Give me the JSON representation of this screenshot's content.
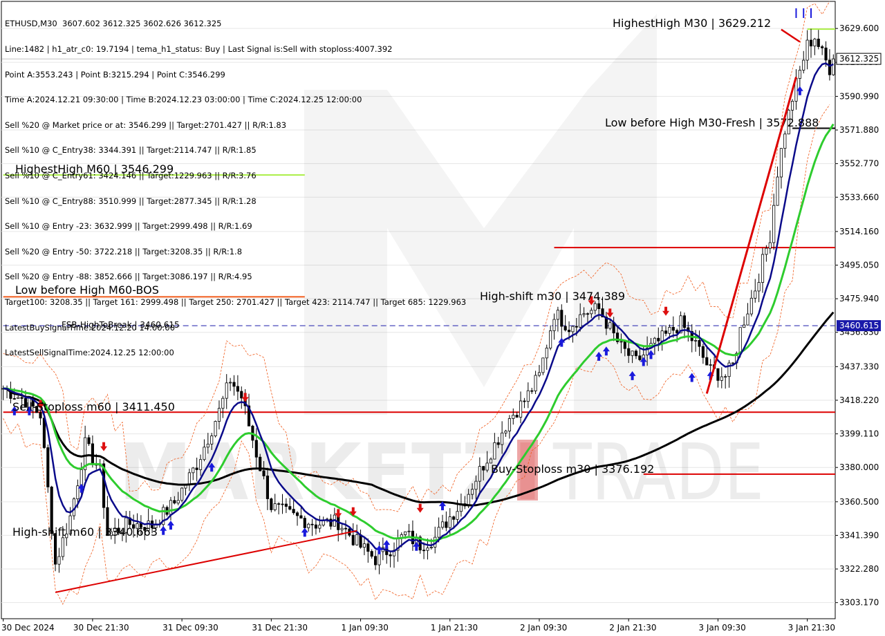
{
  "header": {
    "lines": [
      "ETHUSD,M30  3607.602 3612.325 3602.626 3612.325",
      "Line:1482 | h1_atr_c0: 19.7194 | tema_h1_status: Buy | Last Signal is:Sell with stoploss:4007.392",
      "Point A:3553.243 | Point B:3215.294 | Point C:3546.299",
      "Time A:2024.12.21 09:30:00 | Time B:2024.12.23 03:00:00 | Time C:2024.12.25 12:00:00",
      "Sell %20 @ Market price or at: 3546.299 || Target:2701.427 || R/R:1.83",
      "Sell %10 @ C_Entry38: 3344.391 || Target:2114.747 || R/R:1.85",
      "Sell %10 @ C_Entry61: 3424.146 || Target:1229.963 || R/R:3.76",
      "Sell %10 @ C_Entry88: 3510.999 || Target:2877.345 || R/R:1.28",
      "Sell %10 @ Entry -23: 3632.999 || Target:2999.498 || R/R:1.69",
      "Sell %20 @ Entry -50: 3722.218 || Target:3208.35 || R/R:1.8",
      "Sell %20 @ Entry -88: 3852.666 || Target:3086.197 || R/R:4.95",
      "Target100: 3208.35 || Target 161: 2999.498 || Target 250: 2701.427 || Target 423: 2114.747 || Target 685: 1229.963",
      "LatestBuySignalTime:2024.12.20 14:00:00",
      "LatestSellSignalTime:2024.12.25 12:00:00"
    ]
  },
  "watermark": {
    "brand_left": "MARKETZ",
    "brand_i": "I",
    "brand_right": "TRADE"
  },
  "colors": {
    "bg": "#ffffff",
    "grid": "#e6e6e6",
    "candle": "#000000",
    "fast_ma": "#0a0a8a",
    "mid_ma": "#2ecc2e",
    "slow_ma": "#000000",
    "channel": "#f05a1a",
    "level_red": "#dd0000",
    "level_green": "#aaee44",
    "current_price_bg": "#ffffff",
    "fsb_blue": "#1a1aaa"
  },
  "chart_data": {
    "type": "candlestick",
    "symbol": "ETHUSD",
    "timeframe": "M30",
    "ylim": [
      3294,
      3645
    ],
    "y_ticks": [
      3629.6,
      3610.35,
      3590.99,
      3571.88,
      3552.77,
      3533.66,
      3514.16,
      3495.05,
      3475.94,
      3456.83,
      3437.33,
      3418.22,
      3399.11,
      3380.0,
      3360.5,
      3341.39,
      3322.28,
      3303.17
    ],
    "y_tick_labels": [
      "3629.600",
      "3610.350",
      "3590.990",
      "3571.880",
      "3552.770",
      "3533.660",
      "3514.160",
      "3495.050",
      "3475.940",
      "3456.830",
      "3437.330",
      "3418.220",
      "3399.110",
      "3380.000",
      "3360.500",
      "3341.390",
      "3322.280",
      "3303.170"
    ],
    "x_tick_labels": [
      "30 Dec 2024",
      "30 Dec 21:30",
      "31 Dec 09:30",
      "31 Dec 21:30",
      "1 Jan 09:30",
      "1 Jan 21:30",
      "2 Jan 09:30",
      "2 Jan 21:30",
      "3 Jan 09:30",
      "3 Jan 21:30"
    ],
    "x_tick_index": [
      0,
      24,
      48,
      72,
      96,
      120,
      144,
      168,
      192,
      216
    ],
    "current_price": 3612.325,
    "current_price_label": "3612.325",
    "fsb_level": 3460.615,
    "fsb_label_right": "3460.615",
    "levels": [
      {
        "label": "HighestHigh   M30 | 3629.212",
        "value": 3629.212,
        "color": "#aaee44",
        "x0": 216,
        "x1": 224
      },
      {
        "label": "Low before High   M30-Fresh | 3572.888",
        "value": 3572.888,
        "color": "#000000",
        "x0": 212,
        "x1": 224
      },
      {
        "label": "HighestHigh   M60 | 3546.299",
        "value": 3546.299,
        "color": "#aaee44",
        "x0": 0,
        "x1": 81
      },
      {
        "label": "",
        "value": 3505.0,
        "color": "#dd0000",
        "x0": 148,
        "x1": 300
      },
      {
        "label": "High-shift m30 | 3474.389",
        "value": 3474.389,
        "color": "",
        "x0": 172,
        "x1": 172
      },
      {
        "label": "Low before High   M60-BOS",
        "value": 3477.0,
        "color": "#f05a1a",
        "x0": 0,
        "x1": 81
      },
      {
        "label": "FSB-HighToBreak | 3460.615",
        "value": 3460.615,
        "color": "#1a1aaa",
        "x0": 0,
        "x1": 300
      },
      {
        "label": "Sell-Stoploss m60 | 3411.450",
        "value": 3411.45,
        "color": "#dd0000",
        "x0": 0,
        "x1": 300
      },
      {
        "label": "Buy-Stoploss m30 | 3376.192",
        "value": 3376.192,
        "color": "#dd0000",
        "x0": 172,
        "x1": 300
      },
      {
        "label": "High-shift m60 | 3340.663",
        "value": 3340.663,
        "color": "",
        "x0": 0,
        "x1": 100
      }
    ],
    "candle_count": 224,
    "price_path": [
      [
        0,
        3425
      ],
      [
        6,
        3418
      ],
      [
        10,
        3410
      ],
      [
        14,
        3325
      ],
      [
        18,
        3352
      ],
      [
        22,
        3393
      ],
      [
        26,
        3378
      ],
      [
        28,
        3342
      ],
      [
        34,
        3348
      ],
      [
        40,
        3347
      ],
      [
        46,
        3360
      ],
      [
        52,
        3382
      ],
      [
        58,
        3412
      ],
      [
        61,
        3430
      ],
      [
        64,
        3420
      ],
      [
        68,
        3388
      ],
      [
        72,
        3358
      ],
      [
        78,
        3352
      ],
      [
        84,
        3348
      ],
      [
        90,
        3349
      ],
      [
        96,
        3335
      ],
      [
        100,
        3328
      ],
      [
        104,
        3334
      ],
      [
        108,
        3342
      ],
      [
        112,
        3336
      ],
      [
        116,
        3340
      ],
      [
        120,
        3352
      ],
      [
        124,
        3362
      ],
      [
        128,
        3378
      ],
      [
        132,
        3393
      ],
      [
        136,
        3408
      ],
      [
        140,
        3418
      ],
      [
        144,
        3432
      ],
      [
        148,
        3468
      ],
      [
        152,
        3460
      ],
      [
        156,
        3468
      ],
      [
        160,
        3470
      ],
      [
        164,
        3455
      ],
      [
        166,
        3448
      ],
      [
        170,
        3440
      ],
      [
        174,
        3448
      ],
      [
        178,
        3455
      ],
      [
        182,
        3462
      ],
      [
        186,
        3450
      ],
      [
        190,
        3435
      ],
      [
        194,
        3432
      ],
      [
        196,
        3438
      ],
      [
        198,
        3458
      ],
      [
        202,
        3482
      ],
      [
        206,
        3512
      ],
      [
        208,
        3548
      ],
      [
        210,
        3572
      ],
      [
        212,
        3590
      ],
      [
        214,
        3605
      ],
      [
        216,
        3620
      ],
      [
        218,
        3625
      ],
      [
        220,
        3615
      ],
      [
        222,
        3607
      ],
      [
        223,
        3612
      ]
    ]
  }
}
